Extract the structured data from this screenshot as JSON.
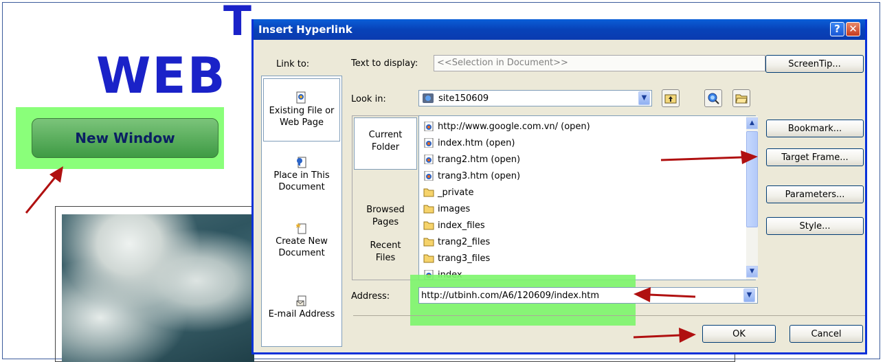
{
  "background": {
    "title_fragment": "T",
    "title_left": "WEB",
    "new_window_button": "New Window"
  },
  "dialog": {
    "title": "Insert Hyperlink",
    "help_label": "?",
    "close_label": "✕",
    "link_to_label": "Link to:",
    "link_to_items": [
      {
        "label": "Existing File or\nWeb Page",
        "icon": "existing-file-icon"
      },
      {
        "label": "Place in This\nDocument",
        "icon": "place-in-document-icon"
      },
      {
        "label": "Create New\nDocument",
        "icon": "create-document-icon"
      },
      {
        "label": "E-mail Address",
        "icon": "email-icon"
      }
    ],
    "text_to_display_label": "Text to display:",
    "text_to_display_value": "<<Selection in Document>>",
    "screentip_button": "ScreenTip...",
    "look_in_label": "Look in:",
    "look_in_value": "site150609",
    "browse_nav": {
      "current_folder": "Current\nFolder",
      "browsed_pages": "Browsed\nPages",
      "recent_files": "Recent\nFiles"
    },
    "files": [
      {
        "name": "http://www.google.com.vn/ (open)",
        "type": "page"
      },
      {
        "name": "index.htm (open)",
        "type": "page"
      },
      {
        "name": "trang2.htm (open)",
        "type": "page"
      },
      {
        "name": "trang3.htm (open)",
        "type": "page"
      },
      {
        "name": "_private",
        "type": "folder"
      },
      {
        "name": "images",
        "type": "folder"
      },
      {
        "name": "index_files",
        "type": "folder"
      },
      {
        "name": "trang2_files",
        "type": "folder"
      },
      {
        "name": "trang3_files",
        "type": "folder"
      },
      {
        "name": "index",
        "type": "page"
      }
    ],
    "address_label": "Address:",
    "address_value": "http://utbinh.com/A6/120609/index.htm",
    "right_buttons": {
      "bookmark": "Bookmark...",
      "target_frame": "Target Frame...",
      "parameters": "Parameters...",
      "style": "Style..."
    },
    "ok_button": "OK",
    "cancel_button": "Cancel"
  },
  "colors": {
    "titlebar": "#0a4fcf",
    "dialog_bg": "#ece9d8",
    "highlight_green": "#7cf56c",
    "arrow_red": "#b01010",
    "title_blue": "#1a22c8"
  }
}
